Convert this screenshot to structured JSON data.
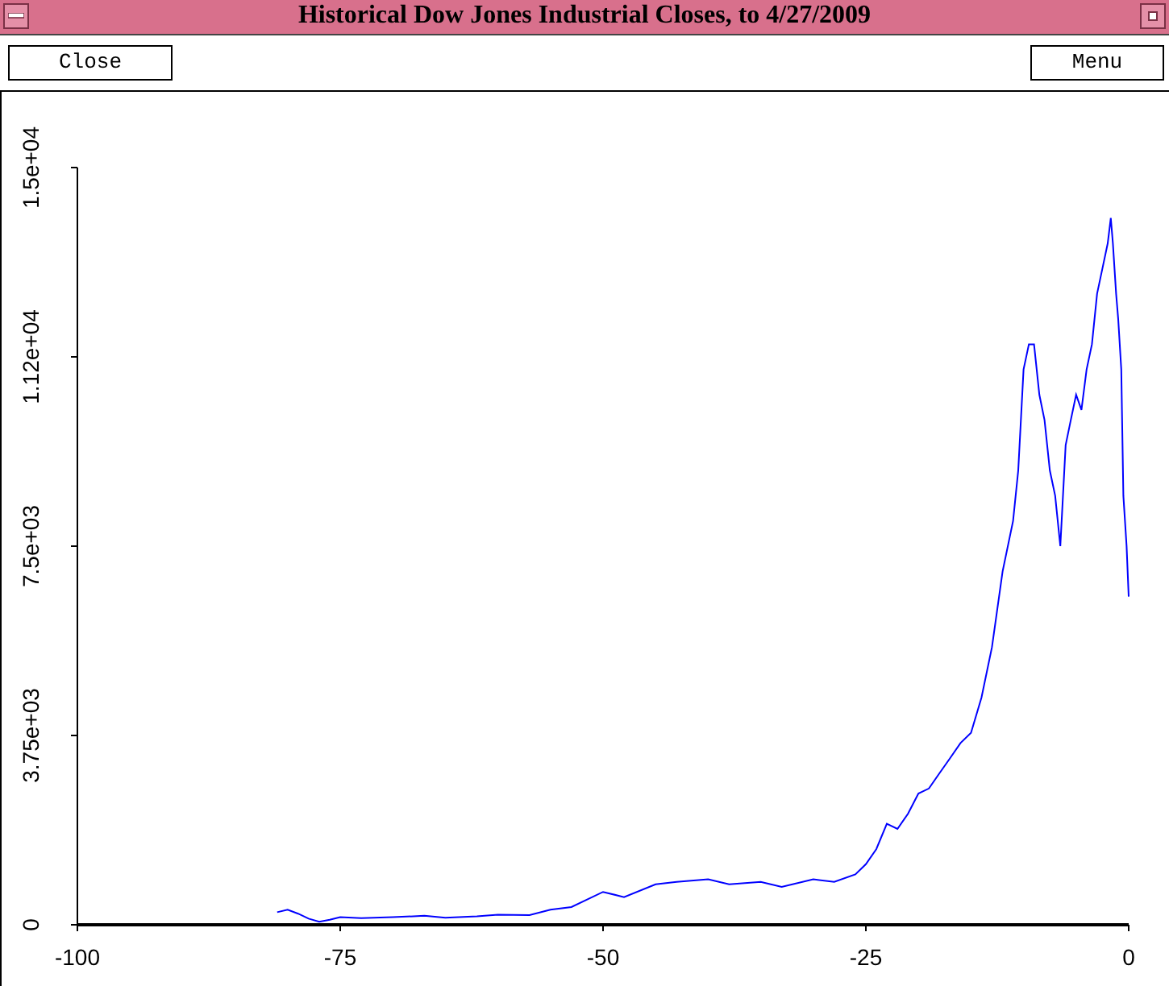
{
  "window": {
    "title": "Historical Dow Jones Industrial Closes, to 4/27/2009"
  },
  "buttons": [
    {
      "label": "Close"
    },
    {
      "label": "Menu"
    }
  ],
  "plot": {
    "chart_data": {
      "type": "line",
      "x": [
        -81,
        -80,
        -79,
        -78,
        -77,
        -76,
        -75,
        -73,
        -70,
        -67,
        -65,
        -62,
        -60,
        -57,
        -55,
        -53,
        -50,
        -48,
        -45,
        -43,
        -40,
        -38,
        -35,
        -33,
        -30,
        -28,
        -26,
        -25,
        -24,
        -23,
        -22,
        -21,
        -20,
        -19,
        -18,
        -17,
        -16,
        -15,
        -14,
        -13,
        -12,
        -11,
        -10.5,
        -10,
        -9.5,
        -9,
        -8.5,
        -8,
        -7.5,
        -7,
        -6.5,
        -6,
        -5.5,
        -5,
        -4.5,
        -4,
        -3.5,
        -3,
        -2.5,
        -2,
        -1.7,
        -1.5,
        -1.2,
        -1,
        -0.7,
        -0.5,
        -0.2,
        0
      ],
      "series": [
        {
          "color": "#0000ff",
          "values": [
            250,
            300,
            220,
            120,
            60,
            100,
            150,
            130,
            150,
            180,
            140,
            170,
            200,
            190,
            300,
            350,
            650,
            550,
            800,
            850,
            900,
            800,
            850,
            750,
            900,
            850,
            1000,
            1200,
            1500,
            2000,
            1900,
            2200,
            2600,
            2700,
            3000,
            3300,
            3600,
            3800,
            4500,
            5500,
            7000,
            8000,
            9000,
            11000,
            11500,
            11500,
            10500,
            10000,
            9000,
            8500,
            7500,
            9500,
            10000,
            10500,
            10200,
            11000,
            11500,
            12500,
            13000,
            13500,
            14000,
            13500,
            12500,
            12000,
            11000,
            8500,
            7500,
            6500
          ]
        }
      ],
      "xlim": [
        -100,
        0
      ],
      "ylim": [
        0,
        15000
      ],
      "xticks": [
        -100,
        -75,
        -50,
        -25,
        0
      ],
      "yticks": [
        {
          "value": 0,
          "label": "0"
        },
        {
          "value": 3750,
          "label": "3.75e+03"
        },
        {
          "value": 7500,
          "label": "7.5e+03"
        },
        {
          "value": 11250,
          "label": "1.12e+04"
        },
        {
          "value": 15000,
          "label": "1.5e+04"
        }
      ]
    }
  }
}
